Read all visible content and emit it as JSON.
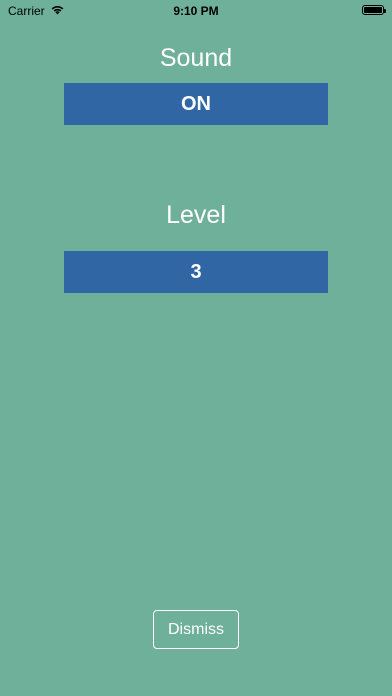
{
  "status_bar": {
    "carrier": "Carrier",
    "time": "9:10 PM",
    "wifi_icon": "wifi-icon",
    "battery_icon": "battery-icon"
  },
  "settings": {
    "sound": {
      "label": "Sound",
      "value": "ON"
    },
    "level": {
      "label": "Level",
      "value": "3"
    }
  },
  "dismiss_label": "Dismiss",
  "colors": {
    "background": "#6fb09a",
    "button": "#2f66a3",
    "text": "#ffffff"
  }
}
